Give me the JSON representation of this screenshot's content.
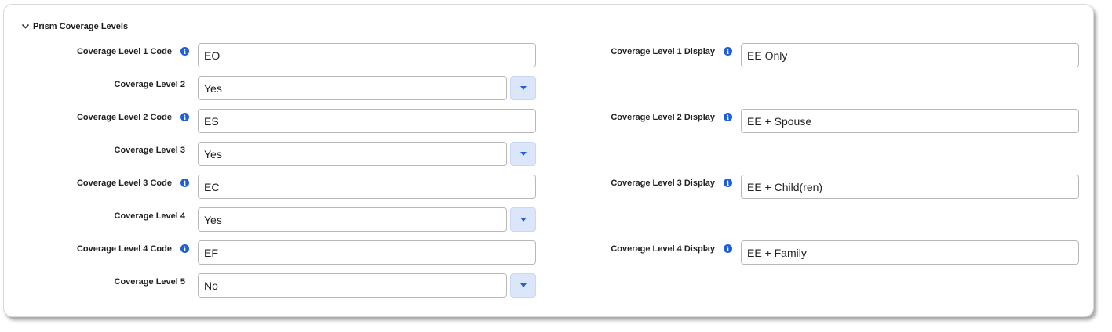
{
  "section": {
    "title": "Prism Coverage Levels"
  },
  "rows": [
    {
      "label": "Coverage Level 1 Code",
      "value": "EO",
      "display_label": "Coverage Level 1 Display",
      "display_value": "EE Only"
    },
    {
      "label": "Coverage Level 2",
      "selected": "Yes"
    },
    {
      "label": "Coverage Level 2 Code",
      "value": "ES",
      "display_label": "Coverage Level 2 Display",
      "display_value": "EE + Spouse"
    },
    {
      "label": "Coverage Level 3",
      "selected": "Yes"
    },
    {
      "label": "Coverage Level 3 Code",
      "value": "EC",
      "display_label": "Coverage Level 3 Display",
      "display_value": "EE + Child(ren)"
    },
    {
      "label": "Coverage Level 4",
      "selected": "Yes"
    },
    {
      "label": "Coverage Level 4 Code",
      "value": "EF",
      "display_label": "Coverage Level 4 Display",
      "display_value": "EE + Family"
    },
    {
      "label": "Coverage Level 5",
      "selected": "No"
    }
  ],
  "icons": {
    "collapse": "chevron-down-icon",
    "info": "info-icon",
    "dropdown": "caret-down-icon"
  },
  "colors": {
    "accent": "#1f5fd6",
    "dropdown_bg": "#dbe6fb",
    "border": "#b8b8b8"
  }
}
